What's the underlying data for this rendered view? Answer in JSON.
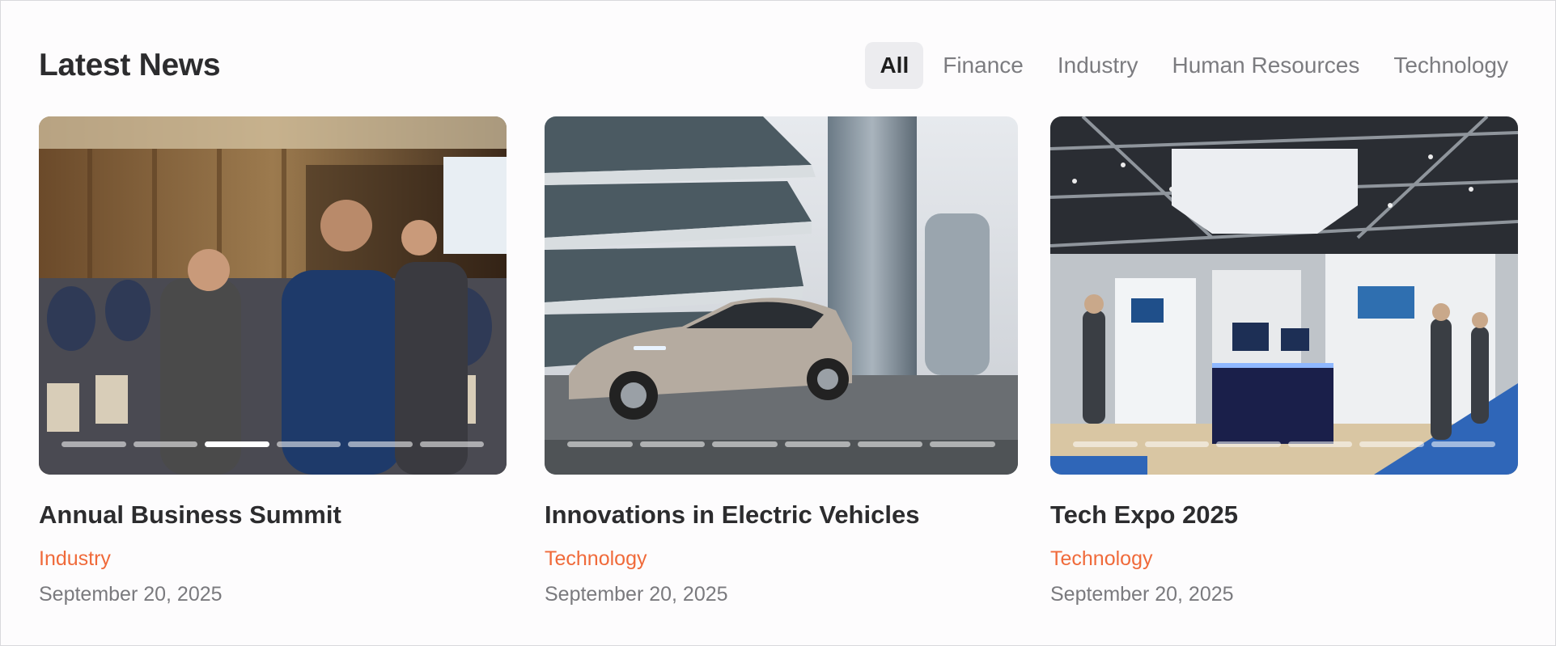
{
  "header": {
    "title": "Latest News"
  },
  "filters": [
    "All",
    "Finance",
    "Industry",
    "Human Resources",
    "Technology"
  ],
  "active_filter": "All",
  "cards": [
    {
      "title": "Annual Business Summit",
      "category": "Industry",
      "date": "September 20, 2025",
      "image_icon": "conference-photo",
      "slide_count": 6,
      "active_slide": 3
    },
    {
      "title": "Innovations in Electric Vehicles",
      "category": "Technology",
      "date": "September 20, 2025",
      "image_icon": "electric-car-photo",
      "slide_count": 6,
      "active_slide": 0
    },
    {
      "title": "Tech Expo 2025",
      "category": "Technology",
      "date": "September 20, 2025",
      "image_icon": "expo-booth-photo",
      "slide_count": 6,
      "active_slide": 0
    }
  ],
  "colors": {
    "category": "#f06a3a",
    "active_filter_bg": "#ececef"
  }
}
